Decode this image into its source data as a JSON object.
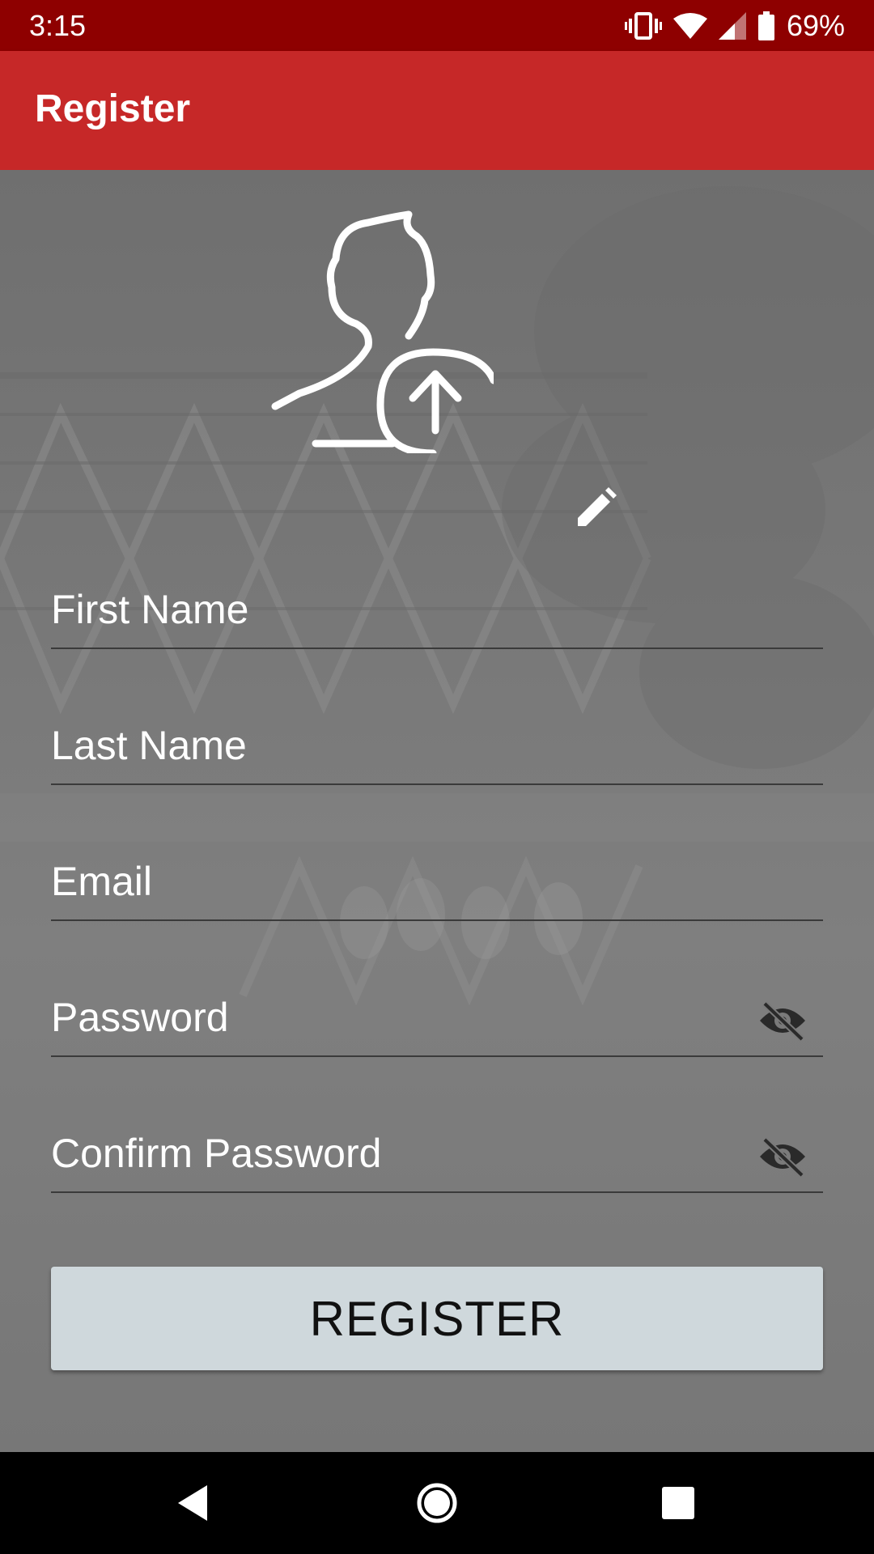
{
  "status_bar": {
    "time": "3:15",
    "battery": "69%",
    "icons": [
      "vibrate-icon",
      "wifi-icon",
      "signal-icon",
      "battery-icon"
    ]
  },
  "app_bar": {
    "title": "Register"
  },
  "avatar": {
    "icon": "user-upload-icon",
    "edit_icon": "edit-pencil-icon"
  },
  "form": {
    "first_name": {
      "placeholder": "First Name",
      "value": ""
    },
    "last_name": {
      "placeholder": "Last Name",
      "value": ""
    },
    "email": {
      "placeholder": "Email",
      "value": ""
    },
    "password": {
      "placeholder": "Password",
      "value": "",
      "toggle_icon": "eye-off-icon"
    },
    "confirm_password": {
      "placeholder": "Confirm Password",
      "value": "",
      "toggle_icon": "eye-off-icon"
    },
    "register_label": "REGISTER"
  },
  "nav_bar": {
    "icons": [
      "back-icon",
      "home-icon",
      "recents-icon"
    ]
  },
  "colors": {
    "status_bar": "#8e0000",
    "app_bar": "#c62828",
    "button": "#cfd8dc"
  }
}
